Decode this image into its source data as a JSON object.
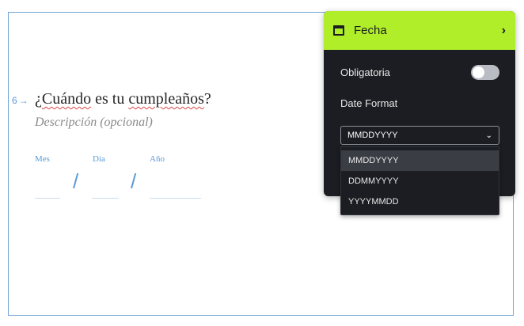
{
  "question": {
    "number": "6",
    "title_start": "¿",
    "title_word1": "Cuándo",
    "title_mid": " es tu ",
    "title_word2": "cumpleaños",
    "title_end": "?",
    "description_placeholder": "Descripción (opcional)"
  },
  "date_fields": {
    "month_label": "Mes",
    "day_label": "Dia",
    "year_label": "Año",
    "separator": "/"
  },
  "panel": {
    "title": "Fecha",
    "required_label": "Obligatoria",
    "required_on": false,
    "format_label": "Date Format",
    "selected_format": "MMDDYYYY",
    "format_options": [
      "MMDDYYYY",
      "DDMMYYYY",
      "YYYYMMDD"
    ],
    "header_color": "#b0ee2a"
  },
  "icons": {
    "header_icon": "calendar-icon",
    "header_chevron": "chevron-right-icon",
    "question_arrow": "arrow-right-icon",
    "select_chevron": "chevron-down-icon"
  }
}
